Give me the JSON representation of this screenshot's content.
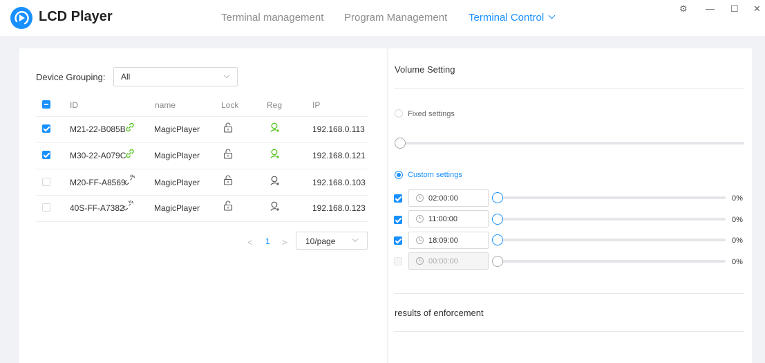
{
  "app": {
    "title": "LCD Player"
  },
  "nav": {
    "items": [
      "Terminal management",
      "Program Management",
      "Terminal Control"
    ],
    "active": "Terminal Control"
  },
  "window_controls": {
    "settings": "⚙",
    "minimize": "—",
    "maximize": "☐",
    "close": "✕"
  },
  "device_grouping": {
    "label": "Device Grouping:",
    "selected": "All"
  },
  "table": {
    "columns": [
      "ID",
      "name",
      "Lock",
      "Reg",
      "IP"
    ],
    "rows": [
      {
        "id": "M21-22-B085B",
        "name": "MagicPlayer",
        "ip": "192.168.0.113",
        "checked": true,
        "online": true
      },
      {
        "id": "M30-22-A079C",
        "name": "MagicPlayer",
        "ip": "192.168.0.121",
        "checked": true,
        "online": true
      },
      {
        "id": "M20-FF-A8569",
        "name": "MagicPlayer",
        "ip": "192.168.0.103",
        "checked": false,
        "online": false
      },
      {
        "id": "40S-FF-A7382",
        "name": "MagicPlayer",
        "ip": "192.168.0.123",
        "checked": false,
        "online": false
      }
    ]
  },
  "pagination": {
    "prev": "<",
    "page": "1",
    "next": ">",
    "page_size": "10/page"
  },
  "volume": {
    "title": "Volume Setting",
    "fixed_label": "Fixed settings",
    "fixed_selected": false,
    "fixed_level": 0,
    "custom_label": "Custom settings",
    "custom_selected": true,
    "schedules": [
      {
        "time": "02:00:00",
        "level": "0%",
        "checked": true,
        "disabled": false
      },
      {
        "time": "11:00:00",
        "level": "0%",
        "checked": true,
        "disabled": false
      },
      {
        "time": "18:09:00",
        "level": "0%",
        "checked": true,
        "disabled": false
      },
      {
        "time": "00:00:00",
        "level": "0%",
        "checked": false,
        "disabled": true
      }
    ]
  },
  "results": {
    "title": "results of enforcement"
  },
  "colors": {
    "accent": "#1890ff",
    "online": "#52c41a"
  }
}
